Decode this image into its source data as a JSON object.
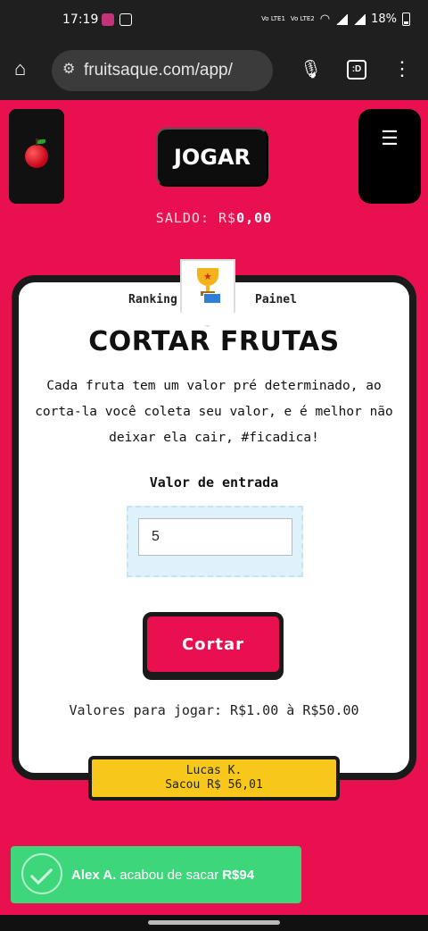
{
  "status_bar": {
    "time": "17:19",
    "lte1": "Vo LTE1",
    "lte2": "Vo LTE2",
    "battery": "18%"
  },
  "browser": {
    "url": "fruitsaque.com/app/",
    "tab_badge": ":D",
    "icons": [
      "home-icon",
      "site-settings-icon",
      "microphone-icon",
      "tabs-icon",
      "more-vert-icon"
    ]
  },
  "header": {
    "play_label": "JOGAR",
    "menu_icon": "☰",
    "saldo_label": "SALDO: R$",
    "saldo_value": "0,00"
  },
  "card": {
    "ranking_label": "Ranking",
    "painel_label": "Painel",
    "title": "CORTAR FRUTAS",
    "description": "Cada fruta tem um valor pré determinado, ao corta-la você coleta seu valor, e é melhor não deixar ela cair, #ficadica!",
    "entry_label": "Valor de entrada",
    "entry_value": "5",
    "cut_button": "Cortar",
    "range_text": "Valores para jogar: R$1.00 à R$50.00"
  },
  "winner": {
    "name": "Lucas K.",
    "text": "Sacou R$ 56,01"
  },
  "toast": {
    "name": "Alex A.",
    "message": "acabou de sacar",
    "amount": "R$94"
  },
  "colors": {
    "background": "#e8104e",
    "dark": "#1a1a1a",
    "winner": "#f7c81b",
    "toast": "#3dd67a"
  }
}
